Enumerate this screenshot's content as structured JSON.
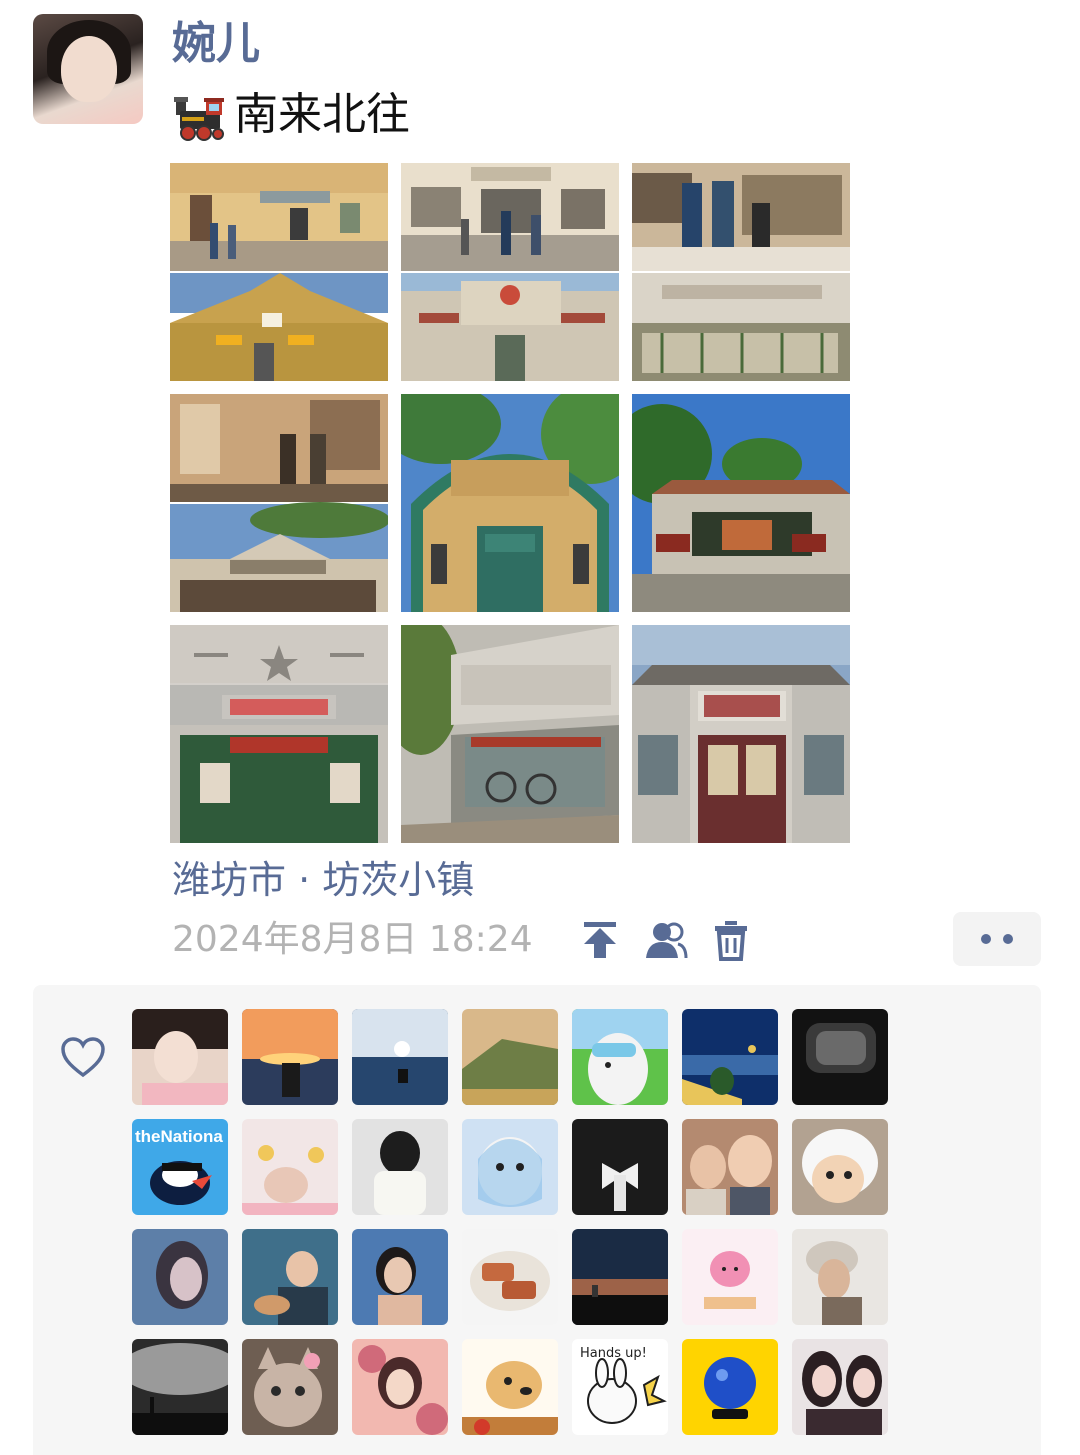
{
  "post": {
    "username": "婉儿",
    "text": "南来北往",
    "text_emoji": "locomotive-icon",
    "location": "潍坊市 · 坊茨小镇",
    "timestamp": "2024年8月8日 18:24"
  },
  "photos": [
    {
      "id": "photo-1",
      "top": "#e8c98a",
      "mid": "#b88a55",
      "bottom": "#3c5f7c"
    },
    {
      "id": "photo-2",
      "top": "#ede3d0",
      "mid": "#9a8f80",
      "bottom": "#4d6a55"
    },
    {
      "id": "photo-3",
      "top": "#dcccb0",
      "mid": "#8a7c6e",
      "bottom": "#56713e"
    },
    {
      "id": "photo-4",
      "top": "#caa67c",
      "mid": "#7b5c40",
      "bottom": "#6b8fba"
    },
    {
      "id": "photo-5",
      "top": "#4f7fc1",
      "mid": "#d1ad6b",
      "bottom": "#2f7a6c"
    },
    {
      "id": "photo-6",
      "top": "#3a72c4",
      "mid": "#9f5a3e",
      "bottom": "#8b8478"
    },
    {
      "id": "photo-7",
      "top": "#d6d6d6",
      "mid": "#c8b6a6",
      "bottom": "#2d5a3f"
    },
    {
      "id": "photo-8",
      "top": "#6e8c4a",
      "mid": "#bdbab0",
      "bottom": "#7a6e60"
    },
    {
      "id": "photo-9",
      "top": "#8aa3c4",
      "mid": "#c4bdb2",
      "bottom": "#6e2f2f"
    }
  ],
  "toolbar": {
    "icons": [
      "pin-top-icon",
      "visibility-icon",
      "delete-icon"
    ],
    "more_icon": "more-dots-icon"
  },
  "likes": {
    "icon": "heart-icon",
    "users": [
      {
        "c1": "#f2ddd2",
        "c2": "#2a1f1c"
      },
      {
        "c1": "#f29c5c",
        "c2": "#2c3c5c"
      },
      {
        "c1": "#d8e3ee",
        "c2": "#26466e"
      },
      {
        "c1": "#d9b88a",
        "c2": "#6e7e46"
      },
      {
        "c1": "#9fd3f0",
        "c2": "#f3f3f3"
      },
      {
        "c1": "#0e2f6a",
        "c2": "#e8c55a"
      },
      {
        "c1": "#3a3a3a",
        "c2": "#121212"
      },
      {
        "c1": "#3fa8e8",
        "c2": "#0d1e40"
      },
      {
        "c1": "#f2e6e6",
        "c2": "#e8c7b7"
      },
      {
        "c1": "#e2e2e2",
        "c2": "#1d1d1d"
      },
      {
        "c1": "#cfe1f3",
        "c2": "#f4f4f4"
      },
      {
        "c1": "#1b1b1b",
        "c2": "#f0f0f0"
      },
      {
        "c1": "#b48a70",
        "c2": "#4e5666"
      },
      {
        "c1": "#f0f0f0",
        "c2": "#cfc7bd"
      },
      {
        "c1": "#5d7fa8",
        "c2": "#d7c2c8"
      },
      {
        "c1": "#3f6f8a",
        "c2": "#283a4a"
      },
      {
        "c1": "#4d7ab2",
        "c2": "#1e3450"
      },
      {
        "c1": "#f5f5f5",
        "c2": "#c5693f"
      },
      {
        "c1": "#1a2b44",
        "c2": "#d67a4a"
      },
      {
        "c1": "#fbeff3",
        "c2": "#f190b4"
      },
      {
        "c1": "#e9e6e2",
        "c2": "#7a6a5c"
      },
      {
        "c1": "#9a9a9a",
        "c2": "#2b2b2b"
      },
      {
        "c1": "#c8b4a6",
        "c2": "#6e5e52"
      },
      {
        "c1": "#f2b8b0",
        "c2": "#d06a7a"
      },
      {
        "c1": "#fffaf0",
        "c2": "#c27d3a"
      },
      {
        "c1": "#ffffff",
        "c2": "#1f1f1f"
      },
      {
        "c1": "#ffd400",
        "c2": "#1f4fc8"
      },
      {
        "c1": "#e9e3e4",
        "c2": "#2b1f22"
      }
    ],
    "thenational_text": "theNationa",
    "handsup_text": "Hands up!"
  },
  "colors": {
    "link": "#586b95",
    "muted": "#b3b3b3",
    "panel": "#f6f6f6"
  }
}
